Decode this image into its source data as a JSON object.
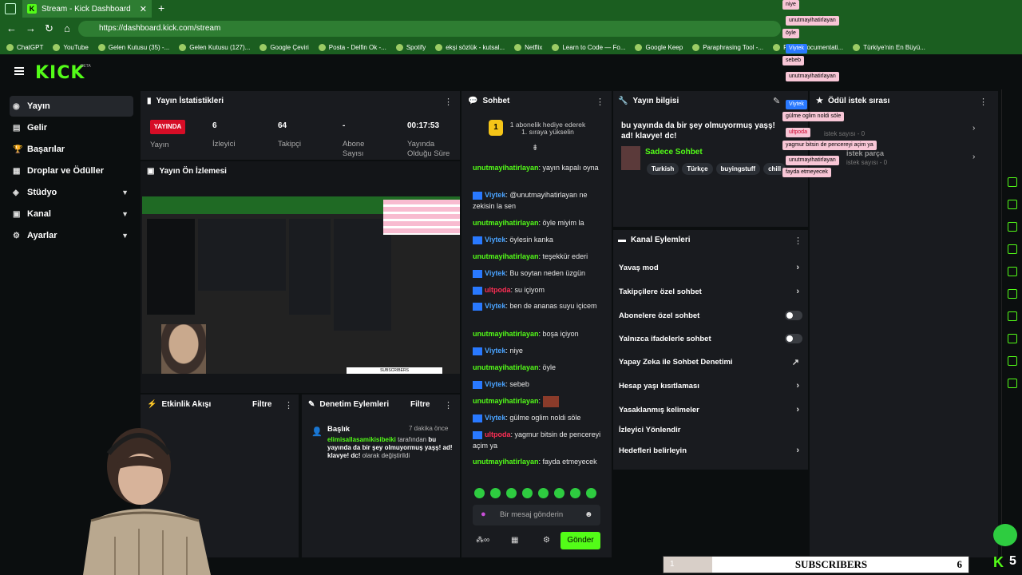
{
  "browser": {
    "tab_title": "Stream - Kick Dashboard",
    "url": "https://dashboard.kick.com/stream",
    "bookmarks": [
      "ChatGPT",
      "YouTube",
      "Gelen Kutusu (35) -...",
      "Gelen Kutusu (127)...",
      "Google Çeviri",
      "Posta - Delfin Ok -...",
      "Spotify",
      "ekşi sözlük - kutsal...",
      "Netflix",
      "Learn to Code — Fo...",
      "Google Keep",
      "Paraphrasing Tool -...",
      "Flutter documentati...",
      "Türkiye'nin En Büyü..."
    ]
  },
  "logo": {
    "text": "KICK",
    "beta": "BETA"
  },
  "sidebar": {
    "items": [
      {
        "label": "Yayın"
      },
      {
        "label": "Gelir"
      },
      {
        "label": "Başarılar"
      },
      {
        "label": "Droplar ve Ödüller"
      },
      {
        "label": "Stüdyo"
      },
      {
        "label": "Kanal"
      },
      {
        "label": "Ayarlar"
      }
    ]
  },
  "stats": {
    "title": "Yayın İstatistikleri",
    "live_badge": "YAYINDA",
    "live_label": "Yayın",
    "viewers_value": "6",
    "viewers_label": "İzleyici",
    "followers_value": "64",
    "followers_label": "Takipçi",
    "subs_value": "-",
    "subs_label_1": "Abone",
    "subs_label_2": "Sayısı",
    "duration_value": "00:17:53",
    "duration_label_1": "Yayında",
    "duration_label_2": "Olduğu Süre"
  },
  "preview": {
    "title": "Yayın Ön İzlemesi"
  },
  "activity": {
    "title": "Etkinlik Akışı",
    "filter": "Filtre"
  },
  "moderation": {
    "title": "Denetim Eylemleri",
    "filter": "Filtre",
    "entry_title": "Başlık",
    "entry_time": "7 dakika önce",
    "entry_user": "elimisallasamikisibeiki",
    "entry_by": "tarafından",
    "entry_quote": "bu yayında da bir şey olmuyormuş yaşş! ad! klavye! dc!",
    "entry_suffix": "olarak değiştirildi"
  },
  "chat": {
    "title": "Sohbet",
    "gift_line1": "1 abonelik hediye ederek",
    "gift_line2": "1. sıraya yükselin",
    "messages": [
      {
        "user": "unutmayihatirlayan",
        "text": "yayın kapalı oyna"
      },
      {
        "user": "Viytek",
        "text": "@unutmayihatirlayan ne zekisin la sen"
      },
      {
        "user": "unutmayihatirlayan",
        "text": "öyle miyim la"
      },
      {
        "user": "Viytek",
        "text": "öylesin kanka"
      },
      {
        "user": "unutmayihatirlayan",
        "text": "teşekkür ederi"
      },
      {
        "user": "Viytek",
        "text": "Bu soytan neden üzgün"
      },
      {
        "user": "ultpoda",
        "text": "su içiyom"
      },
      {
        "user": "Viytek",
        "text": "ben de ananas suyu içicem"
      },
      {
        "user": "unutmayihatirlayan",
        "text": "boşa içiyon"
      },
      {
        "user": "Viytek",
        "text": "niye"
      },
      {
        "user": "unutmayihatirlayan",
        "text": "öyle"
      },
      {
        "user": "Viytek",
        "text": "sebeb"
      },
      {
        "user": "unutmayihatirlayan",
        "text": ""
      },
      {
        "user": "Viytek",
        "text": "gülme oglim noldi söle"
      },
      {
        "user": "ultpoda",
        "text": "yagmur bitsin de pencereyi açim ya"
      },
      {
        "user": "unutmayihatirlayan",
        "text": "fayda etmeyecek"
      }
    ],
    "input_placeholder": "Bir mesaj gönderin",
    "send_label": "Gönder"
  },
  "stream_info": {
    "title": "Yayın bilgisi",
    "stream_title": "bu yayında da bir şey olmuyormuş yaşş! ad! klavye! dc!",
    "category": "Sadece Sohbet",
    "tags": [
      "Turkish",
      "Türkçe",
      "buyingstuff",
      "chill"
    ]
  },
  "reward_queue": {
    "title": "Ödül istek sırası"
  },
  "channel_actions": {
    "title": "Kanal Eylemleri",
    "items": [
      {
        "label": "Yavaş mod"
      },
      {
        "label": "Takipçilere özel sohbet"
      },
      {
        "label": "Abonelere özel sohbet"
      },
      {
        "label": "Yalnızca ifadelerle sohbet"
      },
      {
        "label": "Yapay Zeka ile Sohbet Denetimi"
      },
      {
        "label": "Hesap yaşı kısıtlaması"
      },
      {
        "label": "Yasaklanmış kelimeler"
      },
      {
        "label": "İzleyici Yönlendir"
      },
      {
        "label": "Hedefleri belirleyin"
      }
    ]
  },
  "overlay_chat": [
    "niye",
    "unutmayihatirlayan",
    "öyle",
    "Viytek",
    "sebeb",
    "unutmayihatirlayan",
    "Viytek",
    "gülme oglim noldi söle",
    "ultpoda",
    "yagmur bitsin de pencereyi açim ya",
    "unutmayihatirlayan",
    "fayda etmeyecek"
  ],
  "overlay_reward": {
    "line1": "istek sayısı - 0",
    "line2": "istek parça",
    "line3": "istek sayısı - 0"
  },
  "subs_bar": {
    "start": "1",
    "label": "SUBSCRIBERS",
    "count": "6",
    "progress": 0.16
  },
  "corner": {
    "count": "5"
  }
}
